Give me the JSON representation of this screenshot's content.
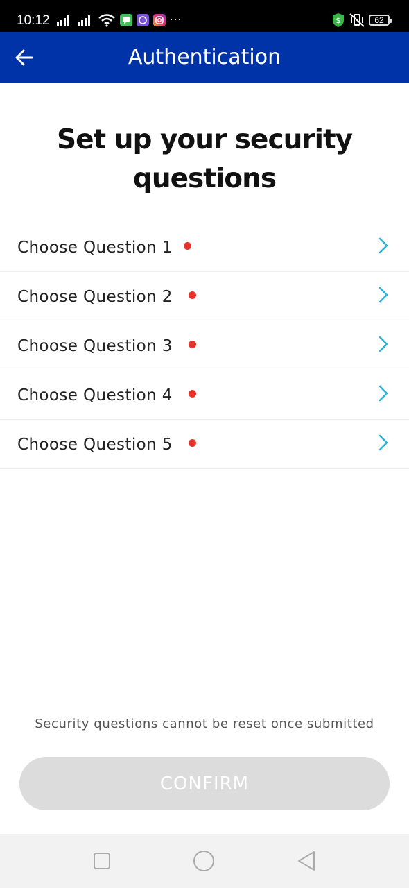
{
  "status_bar": {
    "time": "10:12",
    "battery": "62",
    "more": "···"
  },
  "app_bar": {
    "title": "Authentication"
  },
  "page_title": "Set up your security questions",
  "questions": [
    {
      "label": "Choose Question 1",
      "required": true
    },
    {
      "label": "Choose Question 2",
      "required": true
    },
    {
      "label": "Choose Question 3",
      "required": true
    },
    {
      "label": "Choose Question 4",
      "required": true
    },
    {
      "label": "Choose Question 5",
      "required": true
    }
  ],
  "note": "Security questions cannot be reset once submitted",
  "confirm_button": {
    "label": "CONFIRM",
    "enabled": false
  },
  "colors": {
    "app_bar": "#0133a8",
    "indicator": "#e8322c",
    "chevron": "#2bb3d9",
    "button_disabled": "#dcdcdc"
  },
  "icons": {
    "back": "arrow-left-icon",
    "row": "chevron-right-icon",
    "nav": [
      "square-icon",
      "circle-icon",
      "triangle-back-icon"
    ]
  }
}
